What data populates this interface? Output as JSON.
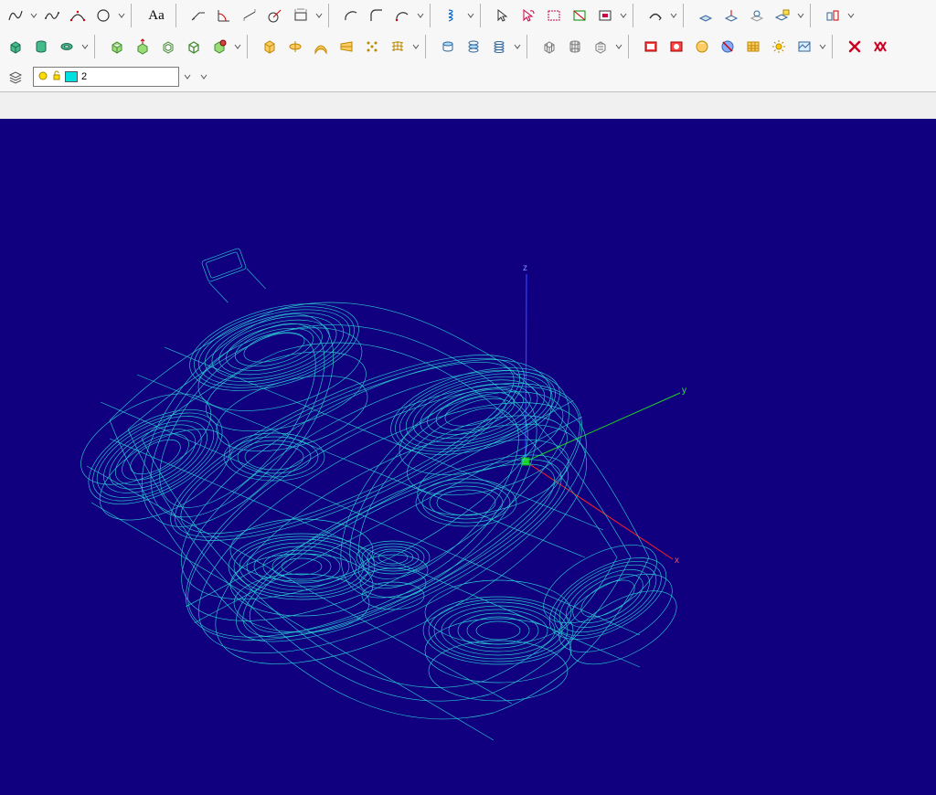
{
  "app": {
    "title": "CAD Application"
  },
  "toolbars": {
    "row1": {
      "text_tool_label": "Aa",
      "groups": [
        [
          "curve-tool-icon",
          "freehand-curve-icon",
          "spline-fit-icon",
          "circle-tool-icon"
        ],
        [
          "text-tool"
        ],
        [
          "leader-line-icon",
          "angular-dim-icon",
          "linear-dim-icon",
          "radial-dim-icon",
          "ordinate-dim-icon"
        ],
        [
          "arc-tool-icon",
          "fillet-arc-icon",
          "tangent-arc-icon"
        ],
        [
          "helix-tool-icon"
        ],
        [
          "select-arrow-icon",
          "lasso-select-icon",
          "window-select-icon",
          "crossing-select-icon",
          "invert-select-icon"
        ],
        [
          "transform-icon"
        ],
        [
          "cplane-icon",
          "set-cplane-icon",
          "world-cplane-icon",
          "named-cplane-icon"
        ],
        [
          "snap-end-icon",
          "snap-mid-icon"
        ]
      ]
    },
    "row2": {
      "groups": [
        [
          "box-solid-icon",
          "cylinder-solid-icon",
          "torus-solid-icon"
        ],
        [
          "cube-icon",
          "extrude-box-icon",
          "hollow-box-icon",
          "wire-cube-icon",
          "solid-edit-icon"
        ],
        [
          "extrude-icon",
          "revolve-icon",
          "sweep-icon",
          "loft-icon",
          "pattern-icon",
          "network-icon"
        ],
        [
          "cap-icon",
          "slice-icon",
          "contour-icon"
        ],
        [
          "mesh-box-icon",
          "mesh-cylinder-icon",
          "mesh-extract-icon"
        ],
        [
          "render-preview-icon",
          "render-settings-icon",
          "material-browser-icon",
          "hide-material-icon",
          "texture-map-icon",
          "sun-icon",
          "environment-icon"
        ],
        [
          "delete-icon",
          "delete-all-icon"
        ]
      ]
    },
    "layer_row": {
      "layers_label": "2",
      "bulb_icon": "layer-on-icon",
      "lock_icon": "layer-unlocked-icon"
    }
  },
  "viewport": {
    "axes": {
      "x_label": "x",
      "y_label": "y",
      "z_label": "z"
    },
    "background_color": "#100080",
    "wireframe_color": "#2dd9d9"
  }
}
